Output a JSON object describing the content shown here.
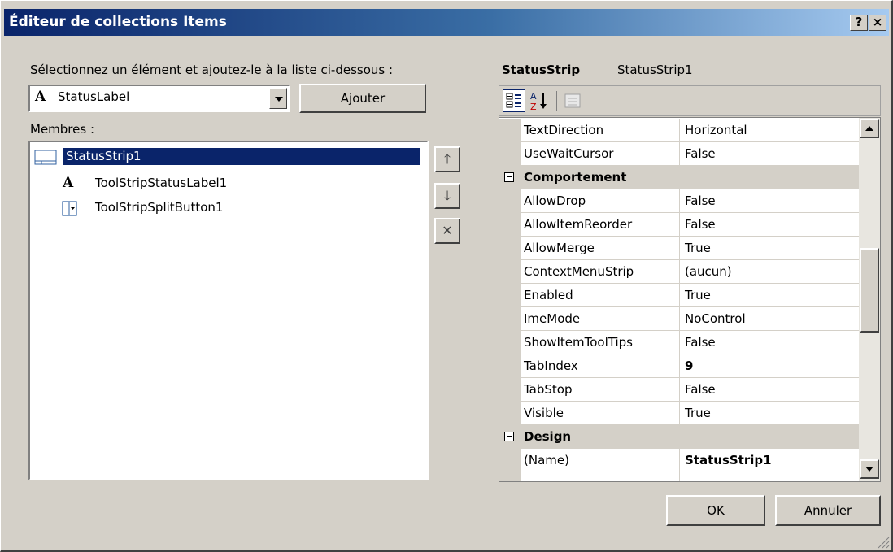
{
  "window": {
    "title": "Éditeur de collections Items",
    "help_label": "?",
    "close_label": "×"
  },
  "add_section": {
    "label": "Sélectionnez un élément et ajoutez-le à la liste ci-dessous :",
    "combo_value": "StatusLabel",
    "combo_icon": "A",
    "add_button": "Ajouter"
  },
  "members": {
    "label": "Membres :",
    "items": [
      {
        "label": "StatusStrip1",
        "icon": "statusstrip-icon",
        "selected": true
      },
      {
        "label": "ToolStripStatusLabel1",
        "icon": "status-label-icon",
        "glyph": "A"
      },
      {
        "label": "ToolStripSplitButton1",
        "icon": "split-button-icon"
      }
    ],
    "move_up_glyph": "🡑",
    "move_down_glyph": "🡓",
    "delete_glyph": "✕"
  },
  "properties": {
    "object_type": "StatusStrip",
    "object_name": "StatusStrip1",
    "toolbar": [
      "categorized-icon",
      "alphabetical-icon",
      "property-pages-icon"
    ],
    "rows": [
      {
        "kind": "prop",
        "name": "TextDirection",
        "value": "Horizontal"
      },
      {
        "kind": "prop",
        "name": "UseWaitCursor",
        "value": "False"
      },
      {
        "kind": "cat",
        "name": "Comportement"
      },
      {
        "kind": "prop",
        "name": "AllowDrop",
        "value": "False"
      },
      {
        "kind": "prop",
        "name": "AllowItemReorder",
        "value": "False"
      },
      {
        "kind": "prop",
        "name": "AllowMerge",
        "value": "True"
      },
      {
        "kind": "prop",
        "name": "ContextMenuStrip",
        "value": "(aucun)"
      },
      {
        "kind": "prop",
        "name": "Enabled",
        "value": "True"
      },
      {
        "kind": "prop",
        "name": "ImeMode",
        "value": "NoControl"
      },
      {
        "kind": "prop",
        "name": "ShowItemToolTips",
        "value": "False"
      },
      {
        "kind": "prop",
        "name": "TabIndex",
        "value": "9",
        "bold": true
      },
      {
        "kind": "prop",
        "name": "TabStop",
        "value": "False"
      },
      {
        "kind": "prop",
        "name": "Visible",
        "value": "True"
      },
      {
        "kind": "cat",
        "name": "Design"
      },
      {
        "kind": "prop",
        "name": "(Name)",
        "value": "StatusStrip1",
        "bold": true
      }
    ]
  },
  "buttons": {
    "ok": "OK",
    "cancel": "Annuler"
  }
}
